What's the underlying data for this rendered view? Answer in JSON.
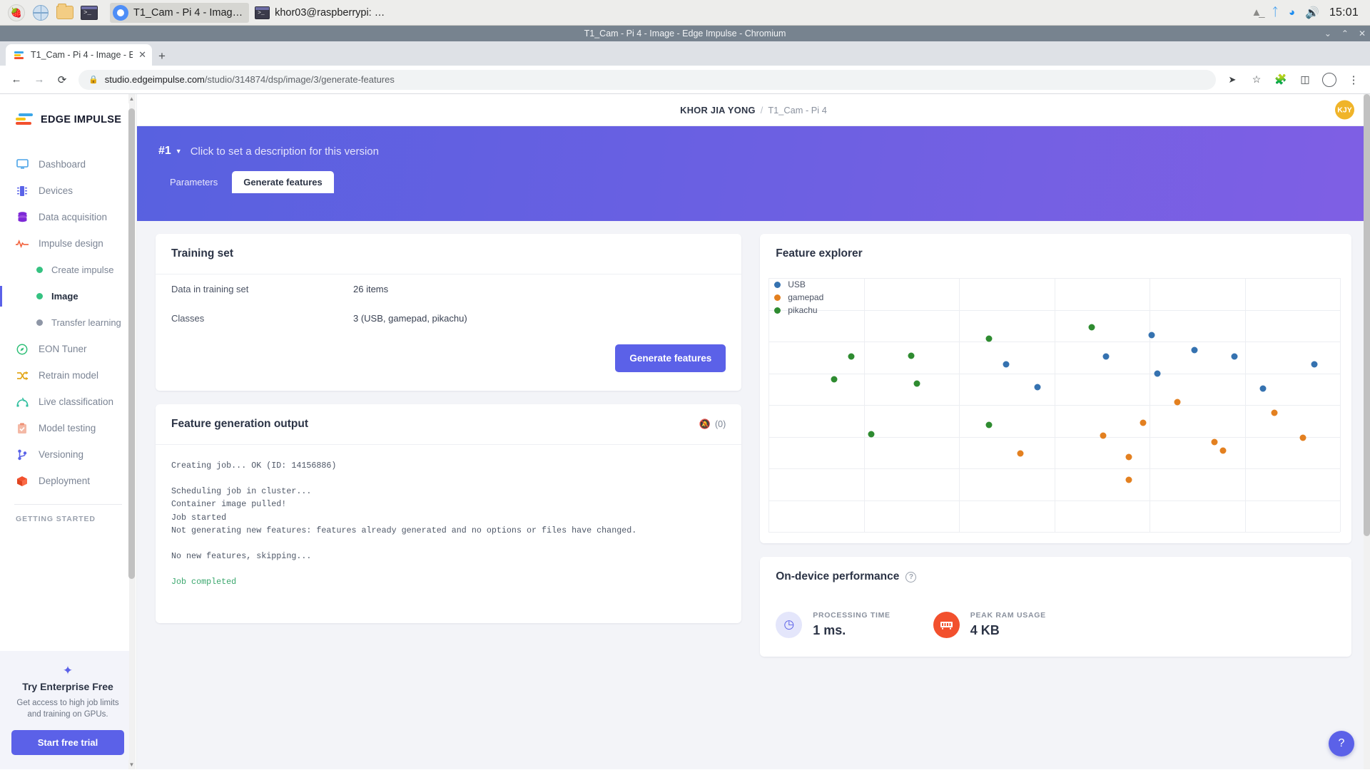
{
  "taskbar": {
    "apps": [
      {
        "name": "raspberry-menu",
        "icon": "raspberry-icon"
      },
      {
        "name": "web-browser",
        "icon": "globe-icon"
      },
      {
        "name": "file-manager",
        "icon": "folder-icon"
      },
      {
        "name": "terminal",
        "icon": "terminal-icon"
      }
    ],
    "windows": [
      {
        "title": "T1_Cam - Pi 4 - Imag…",
        "icon": "chromium-icon",
        "active": true
      },
      {
        "title": "khor03@raspberrypi: …",
        "icon": "terminal-icon",
        "active": false
      }
    ],
    "tray": [
      "eject-icon",
      "bluetooth-icon",
      "wifi-icon",
      "volume-icon"
    ],
    "clock": "15:01"
  },
  "window": {
    "title": "T1_Cam - Pi 4 - Image - Edge Impulse - Chromium",
    "controls": {
      "minimize": "⌄",
      "maximize": "⌃",
      "close": "✕"
    }
  },
  "browser": {
    "tab": {
      "title": "T1_Cam - Pi 4 - Image - E",
      "close": "✕"
    },
    "new_tab": "+",
    "back": "←",
    "forward": "→",
    "reload": "⟳",
    "url_host": "studio.edgeimpulse.com",
    "url_path": "/studio/314874/dsp/image/3/generate-features",
    "actions": [
      "share-icon",
      "bookmark-icon",
      "extensions-icon",
      "side-panel-icon",
      "profile-icon",
      "menu-icon"
    ]
  },
  "sidebar": {
    "brand": "EDGE IMPULSE",
    "items": [
      {
        "label": "Dashboard",
        "icon": "monitor-icon",
        "color": "#4aa3e8",
        "level": 0,
        "active": false
      },
      {
        "label": "Devices",
        "icon": "chip-icon",
        "color": "#5a63e8",
        "level": 0,
        "active": false
      },
      {
        "label": "Data acquisition",
        "icon": "database-icon",
        "color": "#7d29d6",
        "level": 0,
        "active": false
      },
      {
        "label": "Impulse design",
        "icon": "pulse-icon",
        "color": "#f2623d",
        "level": 0,
        "active": false
      },
      {
        "label": "Create impulse",
        "icon": "dot-icon",
        "color": "#35c281",
        "level": 1,
        "active": false
      },
      {
        "label": "Image",
        "icon": "dot-icon",
        "color": "#35c281",
        "level": 1,
        "active": true
      },
      {
        "label": "Transfer learning",
        "icon": "dot-icon",
        "color": "#8e96a6",
        "level": 1,
        "active": false
      },
      {
        "label": "EON Tuner",
        "icon": "compass-icon",
        "color": "#2fbf77",
        "level": 0,
        "active": false
      },
      {
        "label": "Retrain model",
        "icon": "shuffle-icon",
        "color": "#e3a81c",
        "level": 0,
        "active": false
      },
      {
        "label": "Live classification",
        "icon": "waveform-icon",
        "color": "#2fbf9f",
        "level": 0,
        "active": false
      },
      {
        "label": "Model testing",
        "icon": "clipboard-check-icon",
        "color": "#f0a08a",
        "level": 0,
        "active": false
      },
      {
        "label": "Versioning",
        "icon": "git-branch-icon",
        "color": "#5a63e8",
        "level": 0,
        "active": false
      },
      {
        "label": "Deployment",
        "icon": "box-icon",
        "color": "#f2502d",
        "level": 0,
        "active": false
      }
    ],
    "section_label": "GETTING STARTED",
    "promo": {
      "title": "Try Enterprise Free",
      "subtitle": "Get access to high job limits and training on GPUs.",
      "button": "Start free trial",
      "star": "✦"
    }
  },
  "header": {
    "org": "KHOR JIA YONG",
    "separator": "/",
    "project": "T1_Cam - Pi 4",
    "avatar_initials": "KJY"
  },
  "banner": {
    "version": "#1",
    "caret": "▼",
    "description": "Click to set a description for this version",
    "tabs": [
      {
        "label": "Parameters",
        "active": false
      },
      {
        "label": "Generate features",
        "active": true
      }
    ]
  },
  "training_set": {
    "title": "Training set",
    "rows": [
      {
        "key": "Data in training set",
        "value": "26 items"
      },
      {
        "key": "Classes",
        "value": "3 (USB, gamepad, pikachu)"
      }
    ],
    "button": "Generate features"
  },
  "feature_output": {
    "title": "Feature generation output",
    "mute_icon": "muted-bell-icon",
    "count": "(0)",
    "log": "Creating job... OK (ID: 14156886)\n\nScheduling job in cluster...\nContainer image pulled!\nJob started\nNot generating new features: features already generated and no options or files have changed.\n\nNo new features, skipping...\n",
    "log_done": "Job completed"
  },
  "feature_explorer": {
    "title": "Feature explorer"
  },
  "chart_data": {
    "type": "scatter",
    "title": "Feature explorer",
    "xlabel": "",
    "ylabel": "",
    "grid": true,
    "legend_position": "top-left",
    "xlim": [
      0,
      100
    ],
    "ylim": [
      0,
      100
    ],
    "series": [
      {
        "name": "USB",
        "color": "#3572b0",
        "points": [
          [
            67.0,
            22.5
          ],
          [
            41.5,
            34.0
          ],
          [
            59.0,
            31.0
          ],
          [
            74.5,
            28.5
          ],
          [
            68.0,
            37.5
          ],
          [
            81.5,
            31.0
          ],
          [
            95.5,
            34.0
          ],
          [
            47.0,
            43.0
          ],
          [
            86.5,
            43.5
          ]
        ]
      },
      {
        "name": "gamepad",
        "color": "#e38020",
        "points": [
          [
            71.5,
            49.0
          ],
          [
            65.5,
            57.0
          ],
          [
            88.5,
            53.0
          ],
          [
            58.5,
            62.0
          ],
          [
            78.0,
            64.5
          ],
          [
            93.5,
            63.0
          ],
          [
            44.0,
            69.0
          ],
          [
            63.0,
            70.5
          ],
          [
            79.5,
            68.0
          ],
          [
            63.0,
            79.5
          ]
        ]
      },
      {
        "name": "pikachu",
        "color": "#2e8b30",
        "points": [
          [
            56.5,
            19.5
          ],
          [
            38.5,
            24.0
          ],
          [
            14.5,
            31.0
          ],
          [
            25.0,
            30.5
          ],
          [
            11.5,
            40.0
          ],
          [
            26.0,
            41.5
          ],
          [
            38.5,
            58.0
          ],
          [
            18.0,
            61.5
          ]
        ]
      }
    ]
  },
  "performance": {
    "title": "On-device performance",
    "help_icon": "question-icon",
    "metrics": [
      {
        "label": "PROCESSING TIME",
        "value": "1 ms.",
        "icon": "clock-icon",
        "color": "#5b61e8",
        "bg": "#e4e6fb"
      },
      {
        "label": "PEAK RAM USAGE",
        "value": "4 KB",
        "icon": "ram-icon",
        "color": "#f2502d",
        "bg": "#fde4de"
      }
    ]
  },
  "help_fab": {
    "icon": "question-icon",
    "label": "?"
  }
}
